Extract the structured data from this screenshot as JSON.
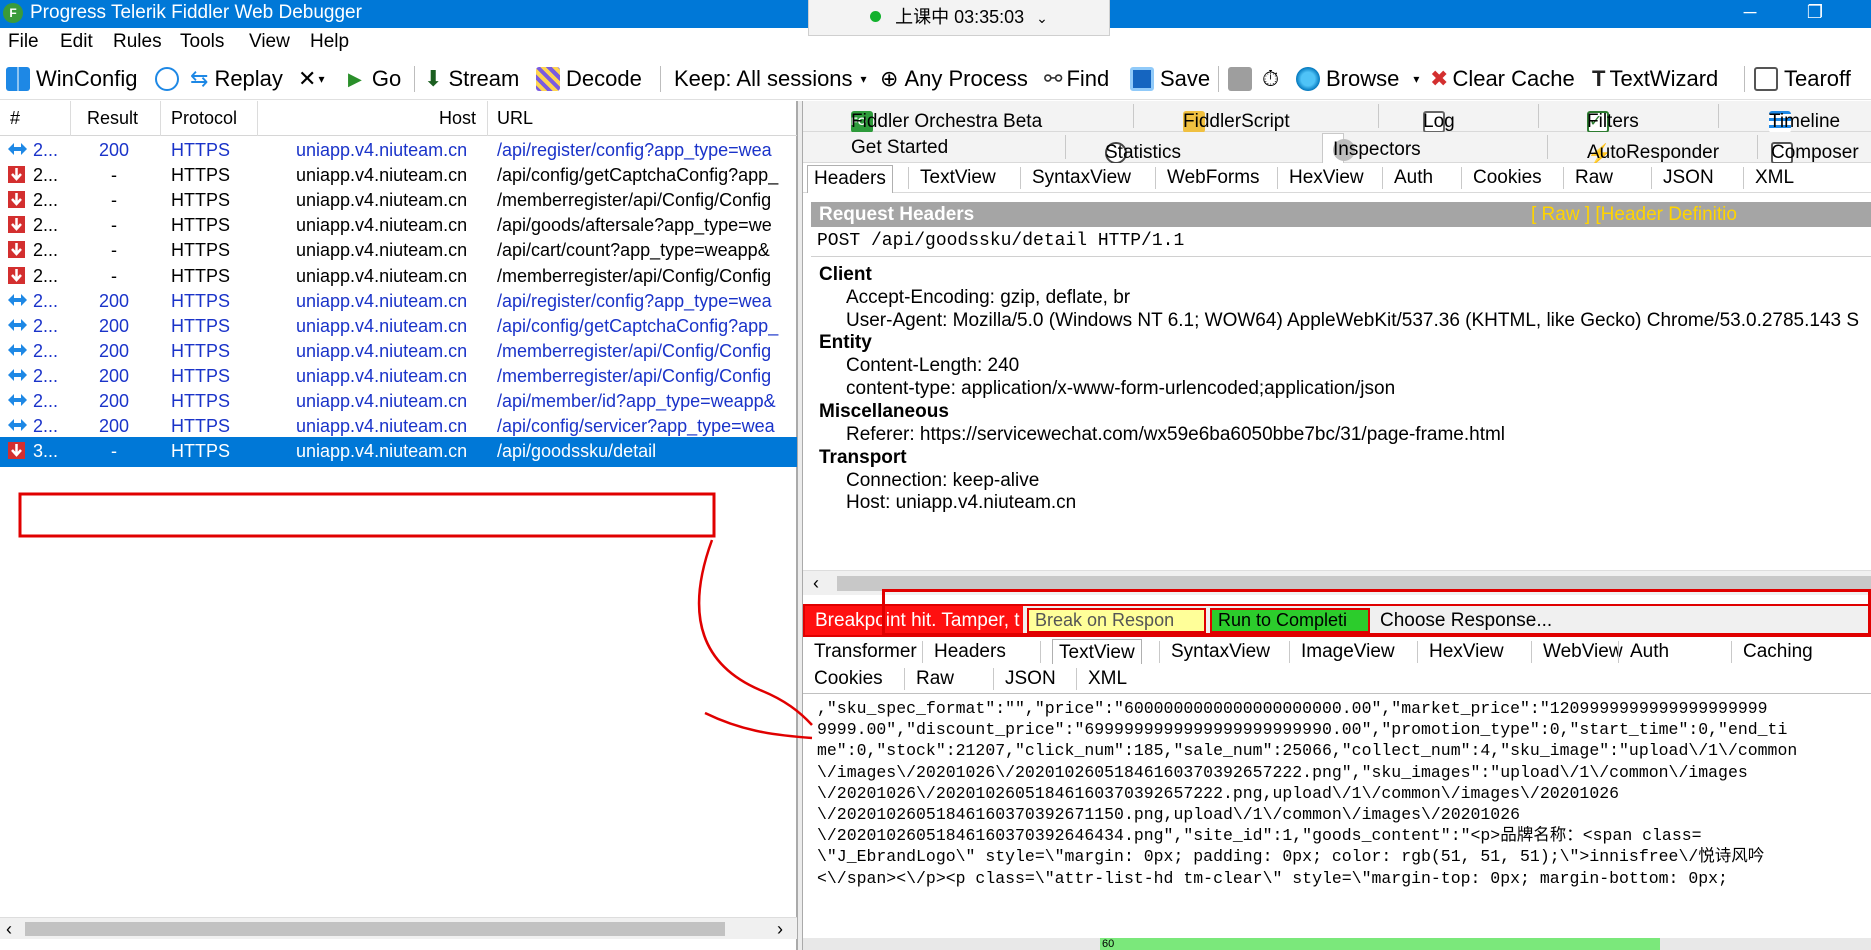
{
  "window": {
    "title": "Progress Telerik Fiddler Web Debugger",
    "app_icon": "fiddler-logo",
    "class_status": "上课中 03:35:03"
  },
  "menu": [
    "File",
    "Edit",
    "Rules",
    "Tools",
    "View",
    "Help"
  ],
  "toolbar": {
    "winconfig": "WinConfig",
    "replay": "Replay",
    "remove": "✕",
    "go": "Go",
    "stream": "Stream",
    "decode": "Decode",
    "keep": "Keep: All sessions",
    "process": "Any Process",
    "find": "Find",
    "save": "Save",
    "browse": "Browse",
    "clear_cache": "Clear Cache",
    "textwizard": "TextWizard",
    "tearoff": "Tearoff"
  },
  "sessions": {
    "columns": {
      "num": "#",
      "result": "Result",
      "protocol": "Protocol",
      "host": "Host",
      "url": "URL"
    },
    "rows": [
      {
        "num": "2...",
        "result": "200",
        "protocol": "HTTPS",
        "host": "uniapp.v4.niuteam.cn",
        "url": "/api/register/config?app_type=wea",
        "state": "done"
      },
      {
        "num": "2...",
        "result": "-",
        "protocol": "HTTPS",
        "host": "uniapp.v4.niuteam.cn",
        "url": "/api/config/getCaptchaConfig?app_",
        "state": "paused"
      },
      {
        "num": "2...",
        "result": "-",
        "protocol": "HTTPS",
        "host": "uniapp.v4.niuteam.cn",
        "url": "/memberregister/api/Config/Config",
        "state": "paused"
      },
      {
        "num": "2...",
        "result": "-",
        "protocol": "HTTPS",
        "host": "uniapp.v4.niuteam.cn",
        "url": "/api/goods/aftersale?app_type=we",
        "state": "paused"
      },
      {
        "num": "2...",
        "result": "-",
        "protocol": "HTTPS",
        "host": "uniapp.v4.niuteam.cn",
        "url": "/api/cart/count?app_type=weapp&",
        "state": "paused"
      },
      {
        "num": "2...",
        "result": "-",
        "protocol": "HTTPS",
        "host": "uniapp.v4.niuteam.cn",
        "url": "/memberregister/api/Config/Config",
        "state": "paused"
      },
      {
        "num": "2...",
        "result": "200",
        "protocol": "HTTPS",
        "host": "uniapp.v4.niuteam.cn",
        "url": "/api/register/config?app_type=wea",
        "state": "done"
      },
      {
        "num": "2...",
        "result": "200",
        "protocol": "HTTPS",
        "host": "uniapp.v4.niuteam.cn",
        "url": "/api/config/getCaptchaConfig?app_",
        "state": "done"
      },
      {
        "num": "2...",
        "result": "200",
        "protocol": "HTTPS",
        "host": "uniapp.v4.niuteam.cn",
        "url": "/memberregister/api/Config/Config",
        "state": "done"
      },
      {
        "num": "2...",
        "result": "200",
        "protocol": "HTTPS",
        "host": "uniapp.v4.niuteam.cn",
        "url": "/memberregister/api/Config/Config",
        "state": "done"
      },
      {
        "num": "2...",
        "result": "200",
        "protocol": "HTTPS",
        "host": "uniapp.v4.niuteam.cn",
        "url": "/api/member/id?app_type=weapp&",
        "state": "done"
      },
      {
        "num": "2...",
        "result": "200",
        "protocol": "HTTPS",
        "host": "uniapp.v4.niuteam.cn",
        "url": "/api/config/servicer?app_type=wea",
        "state": "done"
      },
      {
        "num": "3...",
        "result": "-",
        "protocol": "HTTPS",
        "host": "uniapp.v4.niuteam.cn",
        "url": "/api/goodssku/detail",
        "state": "paused-selected"
      }
    ]
  },
  "inspector": {
    "top_tabs_row1": [
      "Fiddler Orchestra Beta",
      "FiddlerScript",
      "Log",
      "Filters",
      "Timeline"
    ],
    "top_tabs_row2": [
      "Get Started",
      "Statistics",
      "Inspectors",
      "AutoResponder",
      "Composer"
    ],
    "request_tabs": [
      "Headers",
      "TextView",
      "SyntaxView",
      "WebForms",
      "HexView",
      "Auth",
      "Cookies",
      "Raw",
      "JSON",
      "XML"
    ],
    "request_headers_title": "Request Headers",
    "request_headers_links": "[ Raw ]   [Header Definitio",
    "request_line": "POST /api/goodssku/detail HTTP/1.1",
    "header_groups": [
      {
        "name": "Client",
        "items": [
          "Accept-Encoding: gzip, deflate, br",
          "User-Agent: Mozilla/5.0 (Windows NT 6.1; WOW64) AppleWebKit/537.36 (KHTML, like Gecko) Chrome/53.0.2785.143 S"
        ]
      },
      {
        "name": "Entity",
        "items": [
          "Content-Length: 240",
          "content-type: application/x-www-form-urlencoded;application/json"
        ]
      },
      {
        "name": "Miscellaneous",
        "items": [
          "Referer: https://servicewechat.com/wx59e6ba6050bbe7bc/31/page-frame.html"
        ]
      },
      {
        "name": "Transport",
        "items": [
          "Connection: keep-alive",
          "Host: uniapp.v4.niuteam.cn"
        ]
      }
    ],
    "breakpoint": {
      "status": "Breakpoint hit. Tamper, t",
      "break_on_response": "Break on Respon",
      "run_to_completion": "Run to Completi",
      "choose_response": "Choose Response..."
    },
    "response_tabs_row1": [
      "Transformer",
      "Headers",
      "TextView",
      "SyntaxView",
      "ImageView",
      "HexView",
      "WebView",
      "Auth",
      "Caching"
    ],
    "response_tabs_row2": [
      "Cookies",
      "Raw",
      "JSON",
      "XML"
    ],
    "response_body": [
      ",\"sku_spec_format\":\"\",\"price\":\"6000000000000000000000.00\",\"market_price\":\"1209999999999999999999",
      "9999.00\",\"discount_price\":\"6999999999999999999999990.00\",\"promotion_type\":0,\"start_time\":0,\"end_ti",
      "me\":0,\"stock\":21207,\"click_num\":185,\"sale_num\":25066,\"collect_num\":4,\"sku_image\":\"upload\\/1\\/common",
      "\\/images\\/20201026\\/20201026051846160370392657222.png\",\"sku_images\":\"upload\\/1\\/common\\/images",
      "\\/20201026\\/20201026051846160370392657222.png,upload\\/1\\/common\\/images\\/20201026",
      "\\/20201026051846160370392671150.png,upload\\/1\\/common\\/images\\/20201026",
      "\\/20201026051846160370392646434.png\",\"site_id\":1,\"goods_content\":\"<p>品牌名称：<span class=",
      "\\\"J_EbrandLogo\\\" style=\\\"margin: 0px; padding: 0px; color: rgb(51, 51, 51);\\\">innisfree\\/悦诗风吟",
      "<\\/span><\\/p><p class=\\\"attr-list-hd tm-clear\\\" style=\\\"margin-top: 0px; margin-bottom: 0px;"
    ],
    "status_progress_label": "60"
  },
  "colors": {
    "title_bar": "#0078d7",
    "selected_row": "#0078d7",
    "link_rows": "#1a33c9",
    "annotation": "#e00000",
    "breakpoint": "#ff1010",
    "run_button": "#2ccc2c",
    "break_button": "#ffff99"
  }
}
